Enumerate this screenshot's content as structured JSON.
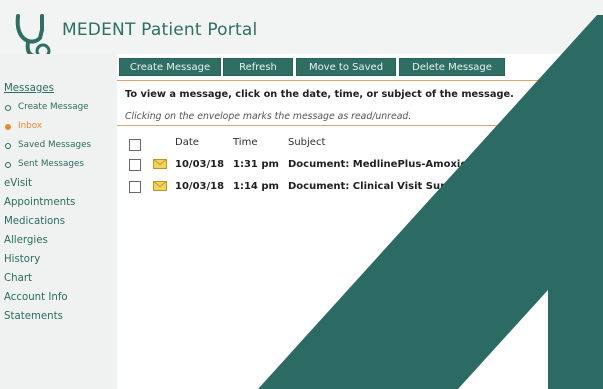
{
  "app": {
    "title": "MEDENT Patient Portal",
    "logo": "stethoscope-icon"
  },
  "toolbar": {
    "create_label": "Create Message",
    "refresh_label": "Refresh",
    "move_label": "Move to Saved",
    "delete_label": "Delete Message"
  },
  "sidebar": {
    "messages_label": "Messages",
    "sub": [
      "Create Message",
      "Inbox",
      "Saved Messages",
      "Sent Messages"
    ],
    "items": [
      "eVisit",
      "Appointments",
      "Medications",
      "Allergies",
      "History",
      "Chart",
      "Account Info",
      "Statements"
    ]
  },
  "info": {
    "line1": "To view a message, click on the date, time, or subject of the message.",
    "line2": "Clicking on the envelope marks the message as read/unread."
  },
  "table": {
    "columns": [
      "Date",
      "Time",
      "Subject"
    ],
    "rows": [
      {
        "date": "10/03/18",
        "time": "1:31 pm",
        "subject": "Document: MedlinePlus-Amoxicill"
      },
      {
        "date": "10/03/18",
        "time": "1:14 pm",
        "subject": "Document: Clinical Visit Summ"
      }
    ]
  },
  "colors": {
    "brand": "#2e6e63",
    "accent": "#e58a35",
    "sidebar_bg": "#f0f1f1",
    "overlay": "#2c6b63"
  }
}
